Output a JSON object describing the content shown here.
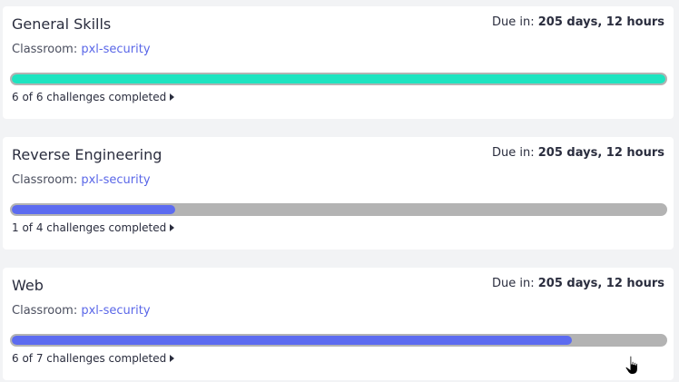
{
  "assignments": [
    {
      "title": "General Skills",
      "due_label": "Due in:",
      "due_value": "205 days, 12 hours",
      "classroom_label": "Classroom:",
      "classroom": "pxl-security",
      "completed_text": "6 of 6 challenges completed",
      "progress": 1.0,
      "progress_color": "#1de4c0"
    },
    {
      "title": "Reverse Engineering",
      "due_label": "Due in:",
      "due_value": "205 days, 12 hours",
      "classroom_label": "Classroom:",
      "classroom": "pxl-security",
      "completed_text": "1 of 4 challenges completed",
      "progress": 0.25,
      "progress_color": "#5c6bf0"
    },
    {
      "title": "Web",
      "due_label": "Due in:",
      "due_value": "205 days, 12 hours",
      "classroom_label": "Classroom:",
      "classroom": "pxl-security",
      "completed_text": "6 of 7 challenges completed",
      "progress": 0.857,
      "progress_color": "#5c6bf0"
    }
  ],
  "icons": {
    "expand": "caret-right-icon",
    "cursor": "hand-pointer-icon"
  },
  "colors": {
    "track": "#b3b3b3",
    "link": "#5a67e8"
  }
}
